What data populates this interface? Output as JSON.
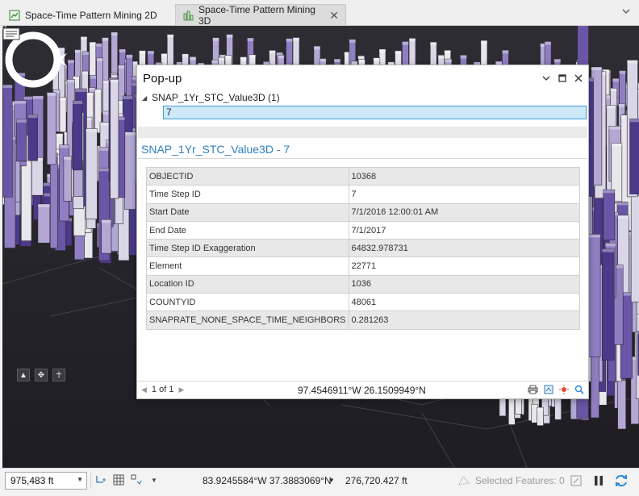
{
  "tabs": [
    {
      "label": "Space-Time Pattern Mining 2D",
      "icon": "map-icon",
      "active": false
    },
    {
      "label": "Space-Time Pattern Mining 3D",
      "icon": "scene-icon",
      "active": true,
      "close": "✕"
    }
  ],
  "popup": {
    "title": "Pop-up",
    "layer": "SNAP_1Yr_STC_Value3D (1)",
    "selected_feature": "7",
    "feature_title": "SNAP_1Yr_STC_Value3D - 7",
    "attributes": [
      {
        "field": "OBJECTID",
        "value": "10368"
      },
      {
        "field": "Time Step ID",
        "value": "7"
      },
      {
        "field": "Start Date",
        "value": "7/1/2016 12:00:01 AM"
      },
      {
        "field": "End Date",
        "value": "7/1/2017"
      },
      {
        "field": "Time Step ID Exaggeration",
        "value": "64832.978731"
      },
      {
        "field": "Element",
        "value": "22771"
      },
      {
        "field": "Location ID",
        "value": "1036"
      },
      {
        "field": "COUNTYID",
        "value": "48061"
      },
      {
        "field": "SNAPRATE_NONE_SPACE_TIME_NEIGHBORS",
        "value": "0.281263"
      }
    ],
    "pager": "1 of 1",
    "location": "97.4546911°W 26.1509949°N"
  },
  "statusbar": {
    "scale": "975,483 ft",
    "coordinates": "83.9245584°W 37.3883069°N",
    "elevation": "276,720.427 ft",
    "selected_features": "Selected Features: 0"
  },
  "colors": {
    "accent": "#2f7fbf",
    "selection_fill": "#cde8f7",
    "selection_border": "#3c9bd6",
    "scene_background": "#26252b",
    "bar_purple": "#6a56a6",
    "bar_white": "#e8e8ec",
    "refresh": "#2b89d8"
  }
}
